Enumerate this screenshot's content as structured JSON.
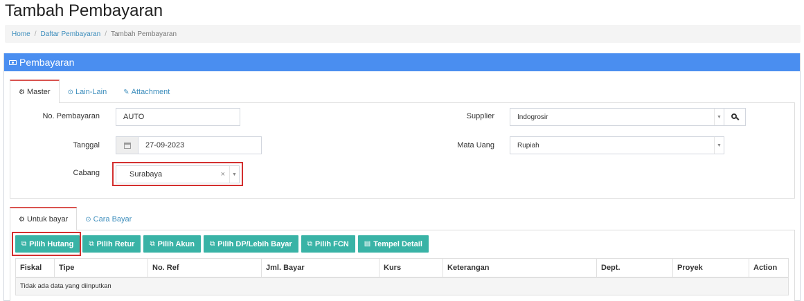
{
  "page": {
    "title": "Tambah Pembayaran"
  },
  "breadcrumb": {
    "items": [
      "Home",
      "Daftar Pembayaran"
    ],
    "current": "Tambah Pembayaran",
    "separator": "/"
  },
  "panel": {
    "title": "Pembayaran",
    "icon": "money-icon",
    "header_color": "#4a8ef0"
  },
  "master_tabs": [
    {
      "label": "Master",
      "icon": "cogs-icon",
      "active": true
    },
    {
      "label": "Lain-Lain",
      "icon": "check-circle-icon",
      "active": false
    },
    {
      "label": "Attachment",
      "icon": "paperclip-icon",
      "active": false
    }
  ],
  "form": {
    "no_pembayaran": {
      "label": "No. Pembayaran",
      "value": "AUTO"
    },
    "tanggal": {
      "label": "Tanggal",
      "value": "27-09-2023",
      "icon": "calendar-icon"
    },
    "cabang": {
      "label": "Cabang",
      "value": "Surabaya",
      "clear": "×"
    },
    "supplier": {
      "label": "Supplier",
      "value": "Indogrosir",
      "search_icon": "search-icon"
    },
    "mata_uang": {
      "label": "Mata Uang",
      "value": "Rupiah"
    }
  },
  "detail_tabs": [
    {
      "label": "Untuk bayar",
      "icon": "cogs-icon",
      "active": true
    },
    {
      "label": "Cara Bayar",
      "icon": "check-circle-icon",
      "active": false
    }
  ],
  "buttons": [
    {
      "label": "Pilih Hutang",
      "icon": "copy-icon"
    },
    {
      "label": "Pilih Retur",
      "icon": "copy-icon"
    },
    {
      "label": "Pilih Akun",
      "icon": "copy-icon"
    },
    {
      "label": "Pilih DP/Lebih Bayar",
      "icon": "copy-icon"
    },
    {
      "label": "Pilih FCN",
      "icon": "copy-icon"
    },
    {
      "label": "Tempel Detail",
      "icon": "paste-icon"
    }
  ],
  "button_color": "#39b3a6",
  "table": {
    "columns": [
      "Fiskal",
      "Tipe",
      "No. Ref",
      "Jml. Bayar",
      "Kurs",
      "Keterangan",
      "Dept.",
      "Proyek",
      "Action"
    ],
    "empty_message": "Tidak ada data yang diinputkan"
  },
  "highlight_color": "#d32f2f"
}
